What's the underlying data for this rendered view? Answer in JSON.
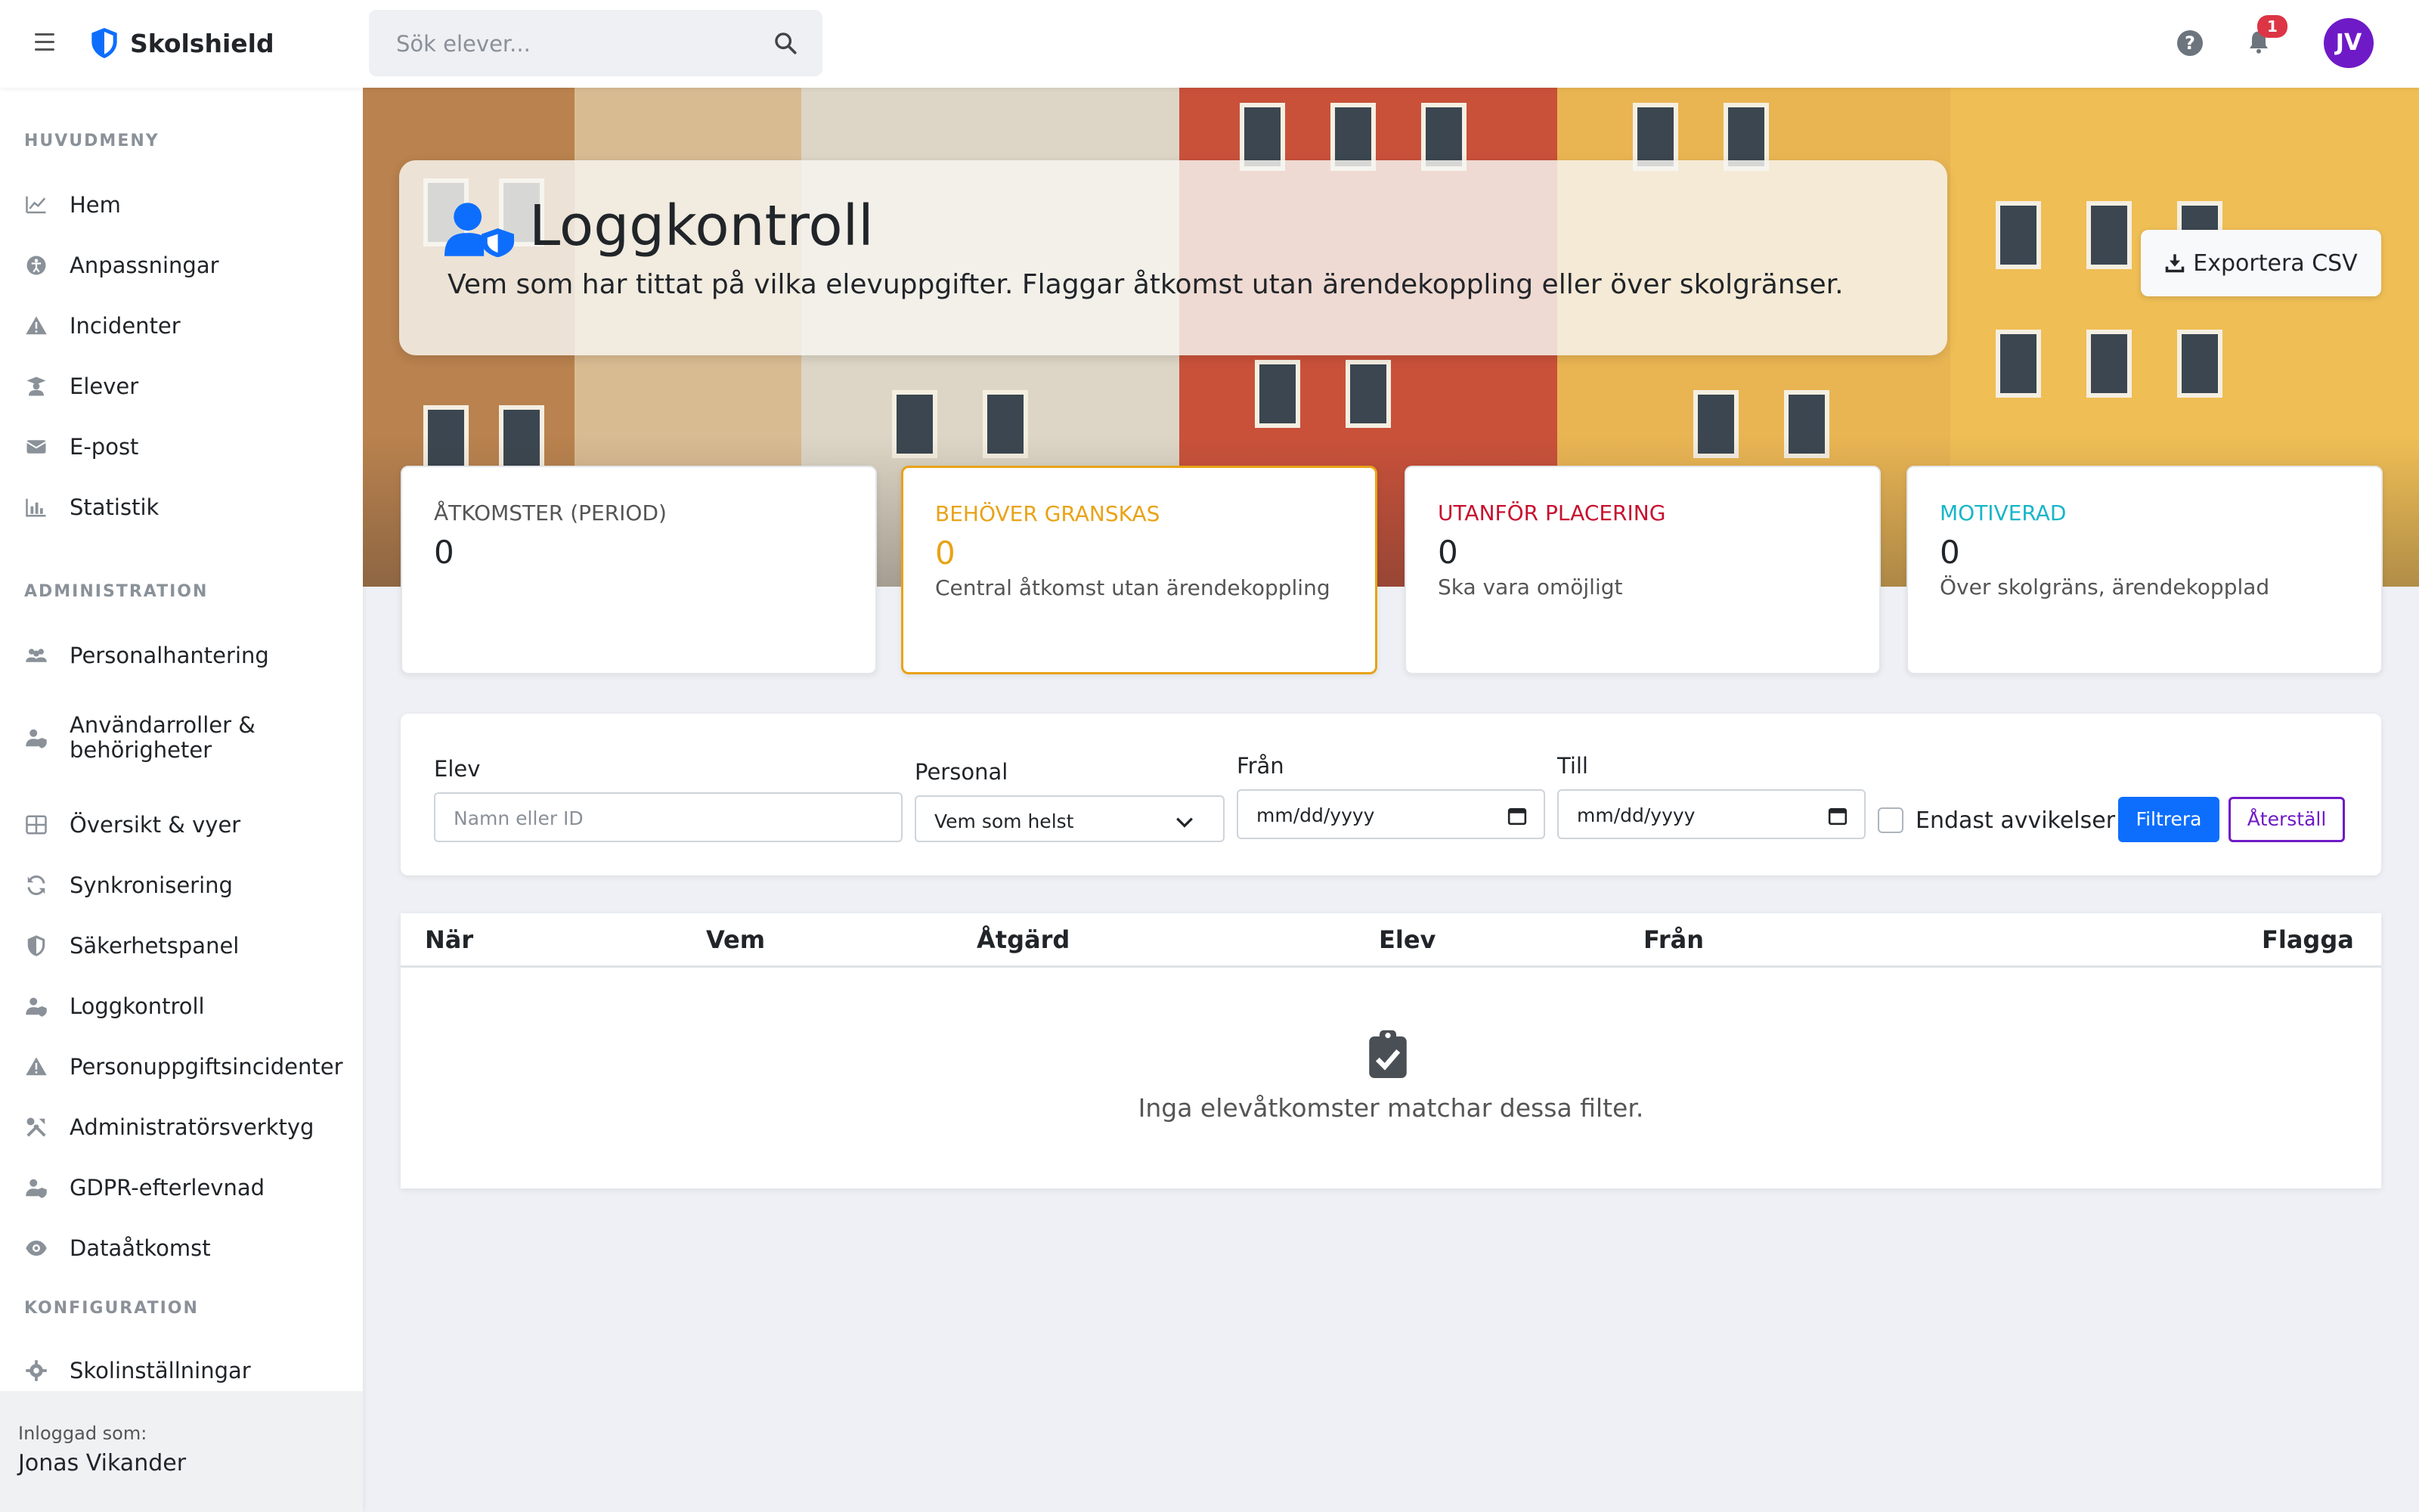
{
  "app": {
    "name": "Skolshield"
  },
  "topbar": {
    "search_placeholder": "Sök elever...",
    "notification_count": "1",
    "help_glyph": "?",
    "avatar_initials": "JV"
  },
  "sidebar": {
    "sections": [
      {
        "title": "HUVUDMENY",
        "items": [
          "Hem",
          "Anpassningar",
          "Incidenter",
          "Elever",
          "E-post",
          "Statistik"
        ]
      },
      {
        "title": "ADMINISTRATION",
        "items": [
          "Personalhantering",
          "Användarroller & behörigheter",
          "Översikt & vyer",
          "Synkronisering",
          "Säkerhetspanel",
          "Loggkontroll",
          "Personuppgiftsincidenter",
          "Administratörsverktyg",
          "GDPR-efterlevnad",
          "Dataåtkomst"
        ]
      },
      {
        "title": "KONFIGURATION",
        "items": [
          "Skolinställningar"
        ]
      }
    ],
    "footer": {
      "label": "Inloggad som:",
      "name": "Jonas Vikander"
    }
  },
  "page": {
    "title": "Loggkontroll",
    "subtitle": "Vem som har tittat på vilka elevuppgifter. Flaggar åtkomst utan ärendekoppling eller över skolgränser.",
    "export_label": "Exportera CSV"
  },
  "stats": [
    {
      "title": "ÅTKOMSTER (PERIOD)",
      "value": "0",
      "desc": "",
      "color": "#555555"
    },
    {
      "title": "BEHÖVER GRANSKAS",
      "value": "0",
      "desc": "Central åtkomst utan ärendekoppling",
      "color": "#e8a317"
    },
    {
      "title": "UTANFÖR PLACERING",
      "value": "0",
      "desc": "Ska vara omöjligt",
      "color": "#c8102e"
    },
    {
      "title": "MOTIVERAD",
      "value": "0",
      "desc": "Över skolgräns, ärendekopplad",
      "color": "#17b6c9"
    }
  ],
  "filters": {
    "student_label": "Elev",
    "student_placeholder": "Namn eller ID",
    "staff_label": "Personal",
    "staff_value": "Vem som helst",
    "from_label": "Från",
    "from_placeholder": "mm/dd/yyyy",
    "to_label": "Till",
    "to_placeholder": "mm/dd/yyyy",
    "only_deviations_label": "Endast avvikelser",
    "filter_button": "Filtrera",
    "reset_button": "Återställ"
  },
  "table": {
    "headers": [
      "När",
      "Vem",
      "Åtgärd",
      "Elev",
      "Från",
      "Flagga"
    ],
    "empty_message": "Inga elevåtkomster matchar dessa filter."
  },
  "colors": {
    "accent": "#0d6efd",
    "brand_purple": "#6f1ac7",
    "warning": "#e8a317",
    "danger": "#c8102e",
    "info": "#17b6c9"
  }
}
